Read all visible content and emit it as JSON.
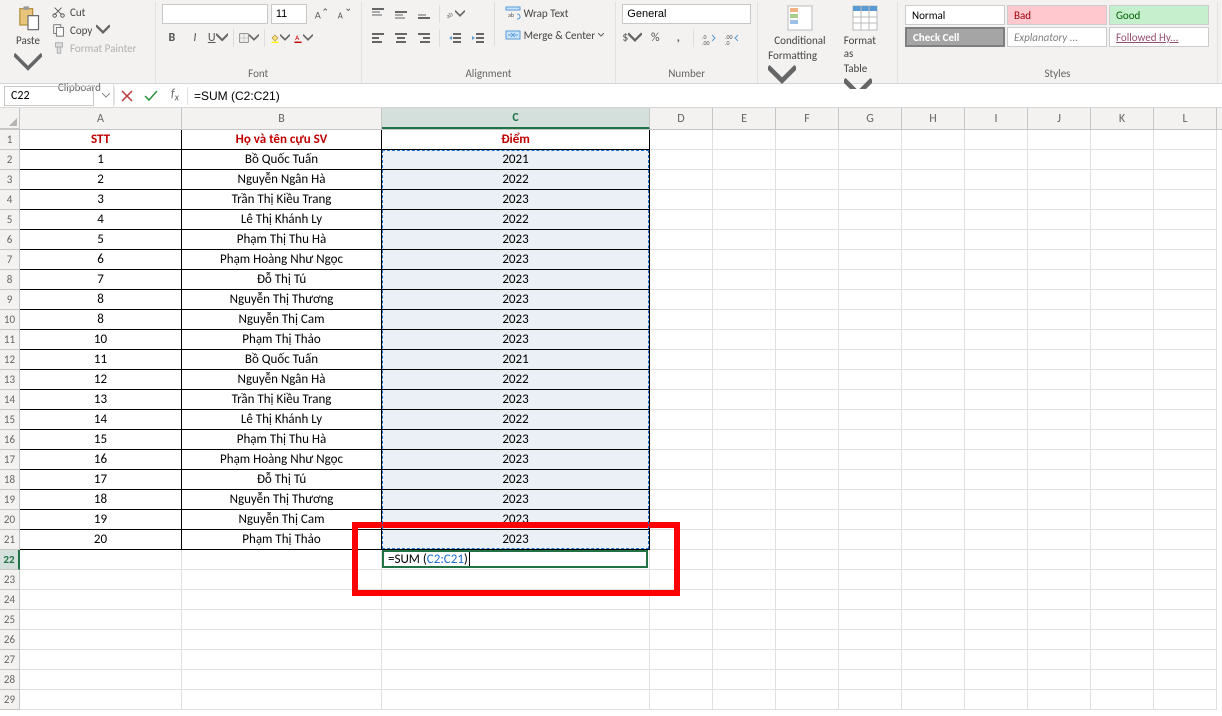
{
  "ribbon": {
    "clipboard": {
      "label": "Clipboard",
      "paste": "Paste",
      "cut": "Cut",
      "copy": "Copy",
      "format_painter": "Format Painter"
    },
    "font": {
      "label": "Font",
      "name": "",
      "size": "11"
    },
    "alignment": {
      "label": "Alignment",
      "wrap": "Wrap Text",
      "merge": "Merge & Center"
    },
    "number": {
      "label": "Number",
      "format": "General"
    },
    "ft": {
      "cond_fmt": "Conditional Formatting",
      "fmt_table": "Format as Table",
      "cond_fmt_l1": "Conditional",
      "cond_fmt_l2": "Formatting",
      "fmt_table_l1": "Format as",
      "fmt_table_l2": "Table"
    },
    "styles": {
      "label": "Styles",
      "normal": "Normal",
      "bad": "Bad",
      "good": "Good",
      "check": "Check Cell",
      "explain": "Explanatory ...",
      "followed": "Followed Hy..."
    }
  },
  "formula_bar": {
    "name_box": "C22",
    "formula": "=SUM (C2:C21)"
  },
  "columns": [
    "A",
    "B",
    "C",
    "D",
    "E",
    "F",
    "G",
    "H",
    "I",
    "J",
    "K",
    "L"
  ],
  "headers": {
    "a": "STT",
    "b": "Họ và tên cựu SV",
    "c": "Điểm"
  },
  "data_rows": [
    {
      "stt": "1",
      "name": "Bồ Quốc Tuấn",
      "score": "2021"
    },
    {
      "stt": "2",
      "name": "Nguyễn Ngân Hà",
      "score": "2022"
    },
    {
      "stt": "3",
      "name": "Trần Thị Kiều Trang",
      "score": "2023"
    },
    {
      "stt": "4",
      "name": "Lê Thị Khánh Ly",
      "score": "2022"
    },
    {
      "stt": "5",
      "name": "Phạm Thị Thu Hà",
      "score": "2023"
    },
    {
      "stt": "6",
      "name": "Phạm Hoàng Như Ngọc",
      "score": "2023"
    },
    {
      "stt": "7",
      "name": "Đỗ Thị Tú",
      "score": "2023"
    },
    {
      "stt": "8",
      "name": "Nguyễn Thị Thương",
      "score": "2023"
    },
    {
      "stt": "8",
      "name": "Nguyễn Thị Cam",
      "score": "2023"
    },
    {
      "stt": "10",
      "name": "Phạm Thị Thảo",
      "score": "2023"
    },
    {
      "stt": "11",
      "name": "Bồ Quốc Tuấn",
      "score": "2021"
    },
    {
      "stt": "12",
      "name": "Nguyễn Ngân Hà",
      "score": "2022"
    },
    {
      "stt": "13",
      "name": "Trần Thị Kiều Trang",
      "score": "2023"
    },
    {
      "stt": "14",
      "name": "Lê Thị Khánh Ly",
      "score": "2022"
    },
    {
      "stt": "15",
      "name": "Phạm Thị Thu Hà",
      "score": "2023"
    },
    {
      "stt": "16",
      "name": "Phạm Hoàng Như Ngọc",
      "score": "2023"
    },
    {
      "stt": "17",
      "name": "Đỗ Thị Tú",
      "score": "2023"
    },
    {
      "stt": "18",
      "name": "Nguyễn Thị Thương",
      "score": "2023"
    },
    {
      "stt": "19",
      "name": "Nguyễn Thị Cam",
      "score": "2023"
    },
    {
      "stt": "20",
      "name": "Phạm Thị Thảo",
      "score": "2023"
    }
  ],
  "edit_cell": {
    "prefix": "=SUM (",
    "range": "C2:C21",
    "suffix": ")"
  },
  "empty_row_count": 7,
  "selected_range": "C2:C21"
}
